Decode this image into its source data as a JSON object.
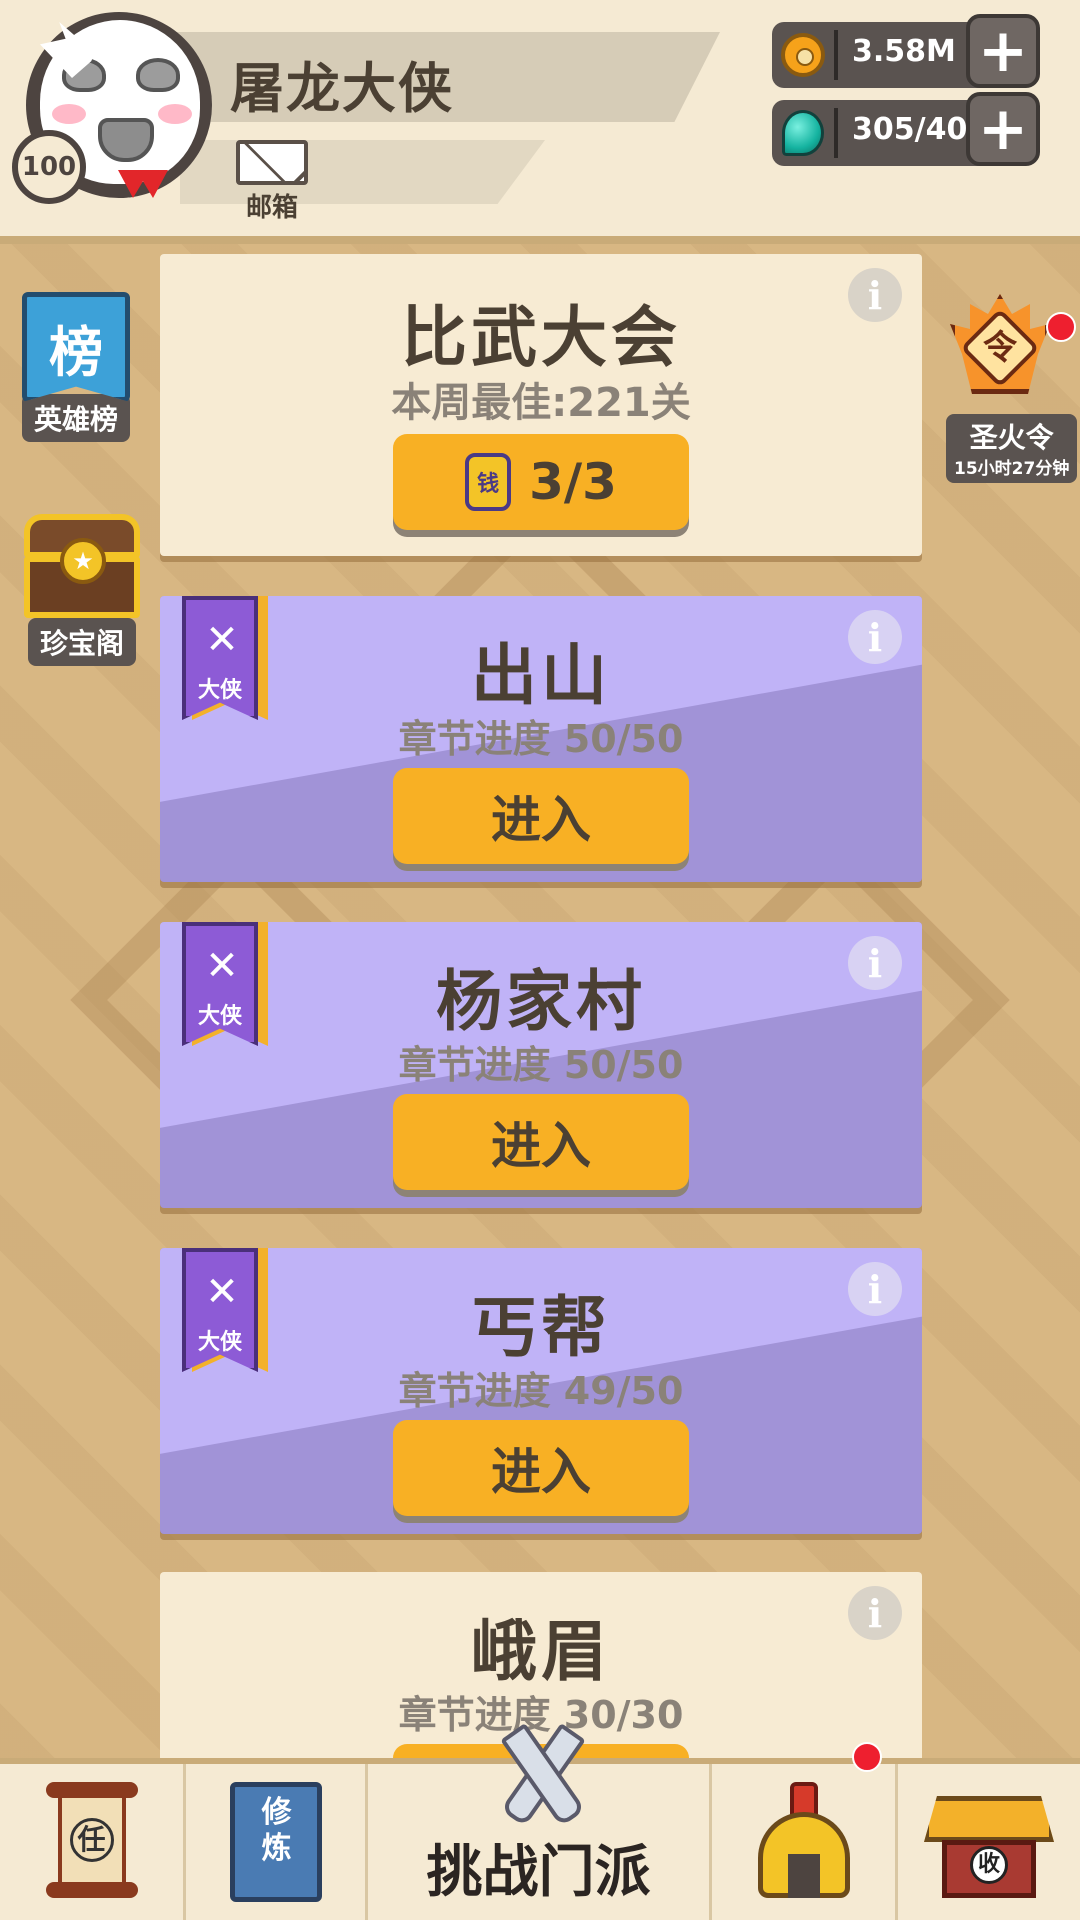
{
  "header": {
    "player_name": "屠龙大侠",
    "level": "100",
    "mailbox_label": "邮箱",
    "currencies": [
      {
        "name": "coin",
        "value": "3.58M",
        "icon": "coin-icon"
      },
      {
        "name": "gem",
        "value": "305/40",
        "icon": "gem-icon"
      }
    ],
    "plus_symbol": "+"
  },
  "side_left": [
    {
      "icon_text": "榜",
      "label": "英雄榜"
    },
    {
      "icon_text": "★",
      "label": "珍宝阁"
    }
  ],
  "side_right": {
    "icon_text": "令",
    "label": "圣火令",
    "timer": "15小时27分钟",
    "has_notification": true
  },
  "arena": {
    "title": "比武大会",
    "best": "本周最佳:221关",
    "ticket_icon_text": "钱",
    "tickets": "3/3",
    "info": "i"
  },
  "chapters": [
    {
      "title": "出山",
      "progress": "章节进度 50/50",
      "button": "进入",
      "tag": "大侠",
      "info": "i"
    },
    {
      "title": "杨家村",
      "progress": "章节进度 50/50",
      "button": "进入",
      "tag": "大侠",
      "info": "i"
    },
    {
      "title": "丐帮",
      "progress": "章节进度 49/50",
      "button": "进入",
      "tag": "大侠",
      "info": "i"
    },
    {
      "title": "峨眉",
      "progress": "章节进度 30/30",
      "info": "i"
    }
  ],
  "bottom_nav": {
    "quest_icon_text": "任",
    "train_icon_text": "修炼",
    "challenge_label": "挑战门派",
    "shop_icon_text": "收",
    "hero_has_notification": true
  },
  "colors": {
    "background": "#d8b783",
    "cream_card": "#f7ebd3",
    "purple_card": "#a193d7",
    "button": "#f8b024",
    "notification": "#ee1f2f"
  }
}
